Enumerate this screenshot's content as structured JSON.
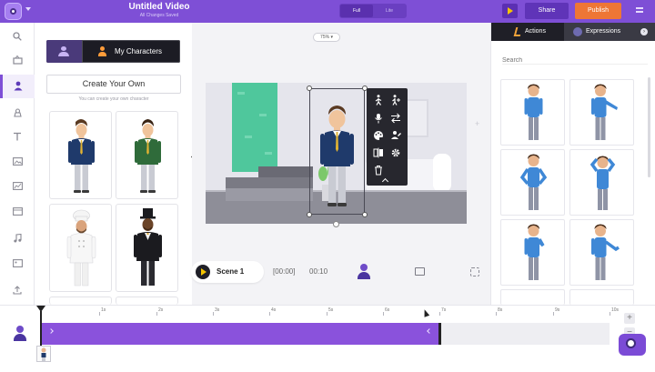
{
  "header": {
    "title": "Untitled Video",
    "subtitle": "All Changes Saved",
    "view_modes": [
      "Full",
      "Lite"
    ],
    "share_label": "Share",
    "publish_label": "Publish",
    "colors": {
      "bar": "#7e4fd6",
      "publish": "#ee7635"
    }
  },
  "left_rail": {
    "items": [
      {
        "icon": "search-icon"
      },
      {
        "icon": "scene-icon"
      },
      {
        "icon": "character-icon",
        "active": true
      },
      {
        "icon": "props-icon"
      },
      {
        "icon": "text-icon"
      },
      {
        "icon": "background-icon"
      },
      {
        "icon": "chart-icon"
      },
      {
        "icon": "video-icon"
      },
      {
        "icon": "music-icon"
      },
      {
        "icon": "image-icon"
      },
      {
        "icon": "upload-icon"
      }
    ]
  },
  "character_panel": {
    "tab_mine_label": "My Characters",
    "create_label": "Create Your Own",
    "create_hint": "You can create your own character",
    "characters": [
      {
        "name": "man-navy-suit"
      },
      {
        "name": "man-green-suit"
      },
      {
        "name": "chef"
      },
      {
        "name": "man-top-hat"
      }
    ]
  },
  "canvas": {
    "zoom_label": "75% ▾"
  },
  "scene_bar": {
    "scene_label": "Scene 1",
    "time_start": "[00:00]",
    "time_end": "00:10"
  },
  "right_panel": {
    "tab_actions": "Actions",
    "tab_expressions": "Expressions",
    "search_placeholder": "Search"
  },
  "timeline": {
    "ticks": [
      "1s",
      "2s",
      "3s",
      "4s",
      "5s",
      "6s",
      "7s",
      "8s",
      "9s",
      "10s"
    ],
    "zoom_in": "+",
    "zoom_out": "−"
  }
}
